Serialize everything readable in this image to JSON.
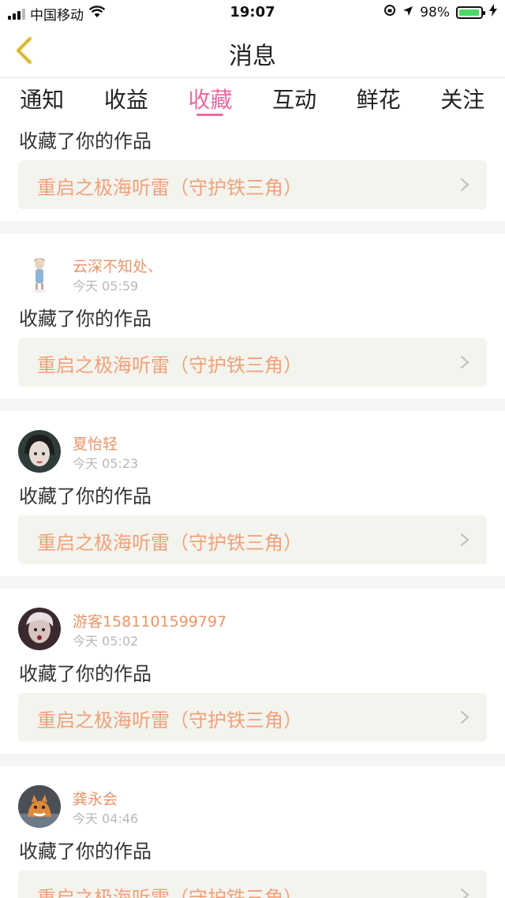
{
  "status_bar": {
    "carrier": "中国移动",
    "time": "19:07",
    "battery_percent": "98%",
    "battery_level": 0.98,
    "accent": "#4cd964"
  },
  "nav": {
    "title": "消息",
    "back_icon": "chevron-left-icon",
    "back_color": "#f2d24a"
  },
  "tabs": [
    {
      "label": "通知",
      "active": false
    },
    {
      "label": "收益",
      "active": false
    },
    {
      "label": "收藏",
      "active": true
    },
    {
      "label": "互动",
      "active": false
    },
    {
      "label": "鲜花",
      "active": false
    },
    {
      "label": "关注",
      "active": false
    }
  ],
  "colors": {
    "active_tab": "#e96aa2",
    "username": "#e8956a",
    "work_title": "#f0a17a",
    "work_bg": "#f4f4ee"
  },
  "messages": [
    {
      "username": "",
      "time": "",
      "action": "收藏了你的作品",
      "work_title": "重启之极海听雷（守护铁三角）"
    },
    {
      "username": "云深不知处、",
      "time": "今天 05:59",
      "action": "收藏了你的作品",
      "work_title": "重启之极海听雷（守护铁三角）"
    },
    {
      "username": "夏怡轻",
      "time": "今天 05:23",
      "action": "收藏了你的作品",
      "work_title": "重启之极海听雷（守护铁三角）"
    },
    {
      "username": "游客1581101599797",
      "time": "今天 05:02",
      "action": "收藏了你的作品",
      "work_title": "重启之极海听雷（守护铁三角）"
    },
    {
      "username": "龚永会",
      "time": "今天 04:46",
      "action": "收藏了你的作品",
      "work_title": "重启之极海听雷（守护铁三角）"
    }
  ]
}
